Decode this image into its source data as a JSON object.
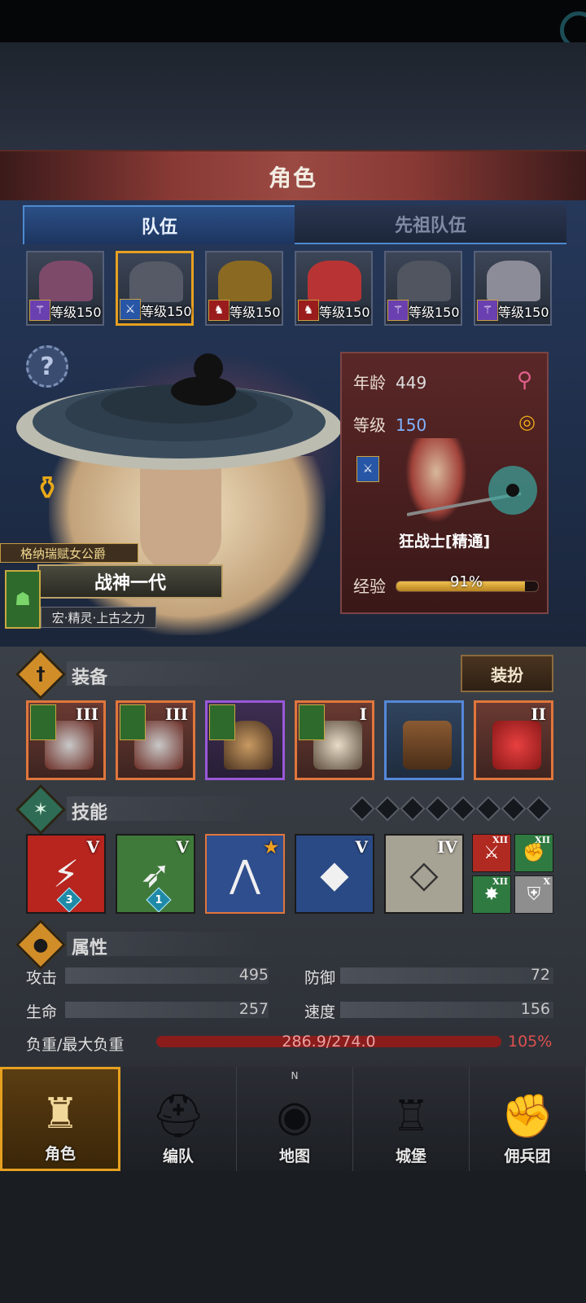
{
  "header": {
    "title": "角色"
  },
  "tabs": [
    {
      "label": "队伍",
      "active": true
    },
    {
      "label": "先祖队伍",
      "active": false
    }
  ],
  "team": [
    {
      "level_text": "等级150",
      "class_icon": "staff-icon",
      "selected": false,
      "color": "#7d4a6a"
    },
    {
      "level_text": "等级150",
      "class_icon": "sword-icon",
      "selected": true,
      "color": "#555a66"
    },
    {
      "level_text": "等级150",
      "class_icon": "beast-icon",
      "selected": false,
      "color": "#8a6a22"
    },
    {
      "level_text": "等级150",
      "class_icon": "beast-icon",
      "selected": false,
      "color": "#b83434"
    },
    {
      "level_text": "等级150",
      "class_icon": "staff-icon",
      "selected": false,
      "color": "#505560"
    },
    {
      "level_text": "等级150",
      "class_icon": "staff-icon",
      "selected": false,
      "color": "#8c8c98"
    }
  ],
  "hero": {
    "title": "格纳瑞赋女公爵",
    "name": "战神一代",
    "subtitle": "宏·精灵·上古之力"
  },
  "info": {
    "age_label": "年龄",
    "age": "449",
    "level_label": "等级",
    "level": "150",
    "class_name": "狂战士[精通]",
    "exp_label": "经验",
    "exp_percent": "91%",
    "exp_fraction": 0.91
  },
  "equipment": {
    "title": "装备",
    "dress_button": "装扮",
    "items": [
      {
        "tier": "III",
        "rarity": "orange",
        "flag": true,
        "icon": "flail-icon"
      },
      {
        "tier": "III",
        "rarity": "orange",
        "flag": true,
        "icon": "flail-icon"
      },
      {
        "tier": "",
        "rarity": "purple",
        "flag": true,
        "icon": "helmet-icon"
      },
      {
        "tier": "I",
        "rarity": "orange",
        "flag": true,
        "icon": "armor-icon"
      },
      {
        "tier": "",
        "rarity": "blue",
        "flag": false,
        "icon": "boots-icon"
      },
      {
        "tier": "II",
        "rarity": "orange",
        "flag": false,
        "icon": "knot-charm-icon"
      }
    ]
  },
  "skills": {
    "title": "技能",
    "items": [
      {
        "tier": "V",
        "level": "3",
        "bg": "#b8241e",
        "icon": "slash-icon"
      },
      {
        "tier": "V",
        "level": "1",
        "bg": "#3f7a3a",
        "icon": "leap-icon"
      },
      {
        "tier": "★",
        "level": "",
        "bg": "#2f4e8e",
        "icon": "claw-icon"
      },
      {
        "tier": "V",
        "level": "",
        "bg": "#2a4a86",
        "icon": "crystal-sword-icon"
      },
      {
        "tier": "IV",
        "level": "",
        "bg": "#a6a294",
        "icon": "crystal-shield-icon"
      }
    ],
    "passives": [
      {
        "tier": "XII",
        "bg": "#b02a22",
        "icon": "sword-icon"
      },
      {
        "tier": "XII",
        "bg": "#2f7a40",
        "icon": "fist-icon"
      },
      {
        "tier": "XII",
        "bg": "#2f7a40",
        "icon": "burst-icon"
      },
      {
        "tier": "X",
        "bg": "#8e8e8e",
        "icon": "shield-icon"
      }
    ]
  },
  "attributes": {
    "title": "属性",
    "attack_label": "攻击",
    "attack": "495",
    "defense_label": "防御",
    "defense": "72",
    "hp_label": "生命",
    "hp": "257",
    "speed_label": "速度",
    "speed": "156",
    "load_label": "负重/最大负重",
    "load": "286.9/274.0",
    "load_percent": "105%"
  },
  "nav": [
    {
      "label": "角色",
      "icon": "knight-icon",
      "active": true
    },
    {
      "label": "编队",
      "icon": "helmet-icon",
      "active": false
    },
    {
      "label": "地图",
      "icon": "compass-map-icon",
      "active": false,
      "compass": "N"
    },
    {
      "label": "城堡",
      "icon": "castle-icon",
      "active": false
    },
    {
      "label": "佣兵团",
      "icon": "mercenary-fist-icon",
      "active": false
    }
  ]
}
